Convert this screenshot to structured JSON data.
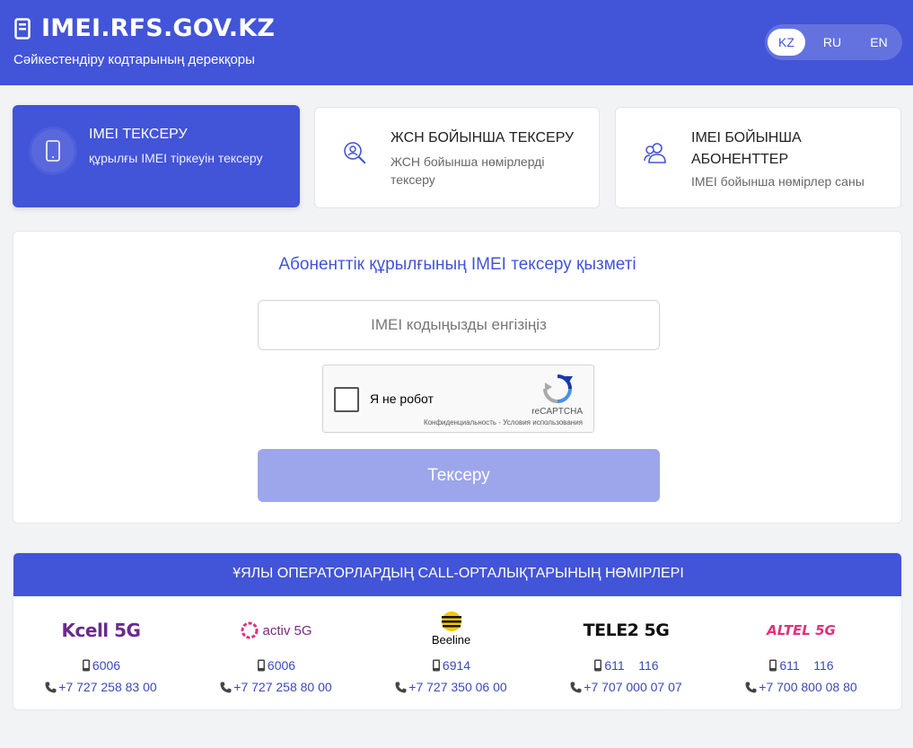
{
  "header": {
    "title": "IMEI.RFS.GOV.KZ",
    "subtitle": "Сәйкестендіру кодтарының дерекқоры",
    "languages": [
      {
        "code": "KZ",
        "active": true
      },
      {
        "code": "RU",
        "active": false
      },
      {
        "code": "EN",
        "active": false
      }
    ]
  },
  "tabs": [
    {
      "title": "IMEI ТЕКСЕРУ",
      "description": "құрылғы IMEI тіркеуін тексеру",
      "icon": "phone-icon",
      "active": true
    },
    {
      "title": "ЖСН БОЙЫНША ТЕКСЕРУ",
      "description": "ЖСН бойынша нөмірлерді тексеру",
      "icon": "user-search-icon",
      "active": false
    },
    {
      "title": "IMEI БОЙЫНША АБОНЕНТТЕР",
      "description": "IMEI бойынша нөмірлер саны",
      "icon": "users-icon",
      "active": false
    }
  ],
  "main": {
    "title": "Абоненттік құрылғының IMEI тексеру қызметі",
    "input_placeholder": "IMEI кодыңызды енгізіңіз",
    "captcha": {
      "label": "Я не робот",
      "brand": "reCAPTCHA",
      "links": "Конфиденциальность - Условия использования"
    },
    "submit_label": "Тексеру"
  },
  "operators": {
    "title": "ҰЯЛЫ ОПЕРАТОРЛАРДЫҢ CALL-ОРТАЛЫҚТАРЫНЫҢ НӨМІРЛЕРІ",
    "items": [
      {
        "name": "Kcell 5G",
        "short": "6006",
        "phone": "+7 727 258 83 00",
        "color": "#6b2a8f"
      },
      {
        "name": "activ 5G",
        "short": "6006",
        "phone": "+7 727 258 80 00",
        "color": "#7b2a7f"
      },
      {
        "name": "Beeline",
        "short": "6914",
        "phone": "+7 727 350 06 00",
        "color": "#000000"
      },
      {
        "name": "TELE2 5G",
        "short": "611    116",
        "phone": "+7 707 000 07 07",
        "color": "#111111"
      },
      {
        "name": "ALTEL 5G",
        "short": "611    116",
        "phone": "+7 700 800 08 80",
        "color": "#e0317b"
      }
    ]
  },
  "colors": {
    "primary": "#4254d8",
    "button_disabled": "#9da6ea",
    "link": "#3a49b8"
  }
}
